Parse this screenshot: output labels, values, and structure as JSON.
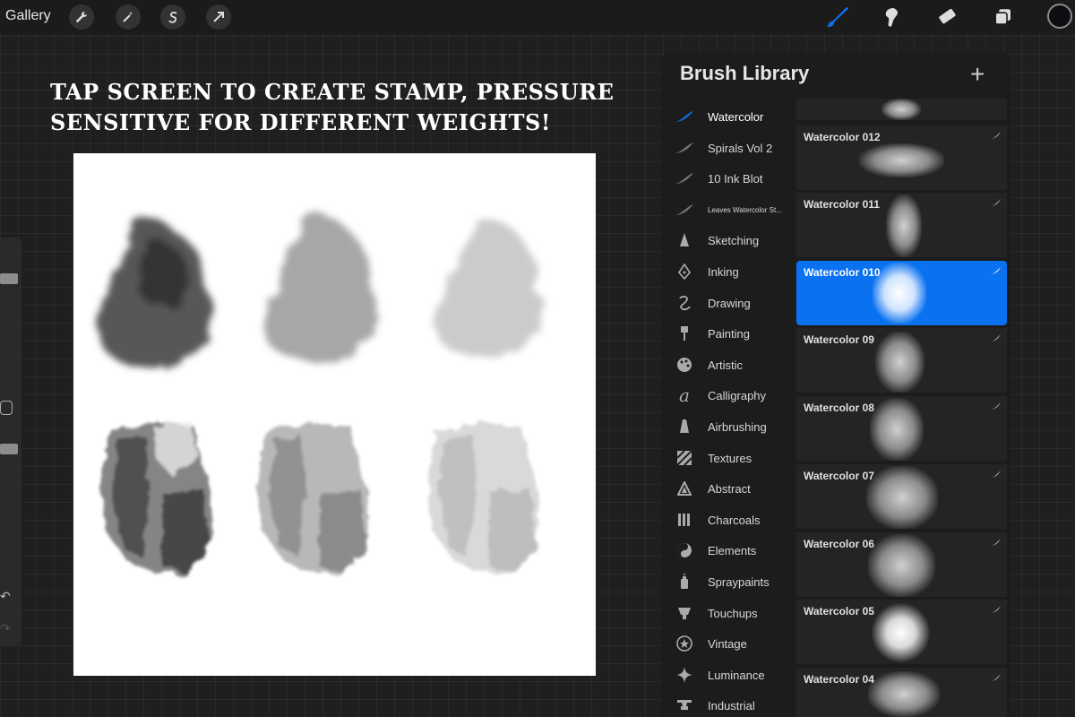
{
  "topbar": {
    "gallery_label": "Gallery",
    "left_tools": [
      "wrench-icon",
      "magic-wand-icon",
      "selection-s-icon",
      "arrow-icon"
    ],
    "right_tools": [
      "brush-icon",
      "smudge-icon",
      "eraser-icon",
      "layers-icon"
    ],
    "active_tool": "brush",
    "accent_color": "#0a72f0",
    "current_color": "#0e0e12"
  },
  "headline": {
    "line1": "TAP SCREEN TO CREATE STAMP, PRESSURE",
    "line2": "SENSITIVE FOR DIFFERENT WEIGHTS!"
  },
  "brush_library": {
    "title": "Brush Library",
    "add_label": "+",
    "categories": [
      {
        "label": "Watercolor",
        "icon": "custom-brush-icon",
        "active": true
      },
      {
        "label": "Spirals Vol 2",
        "icon": "custom-brush-icon"
      },
      {
        "label": "10 Ink Blot",
        "icon": "custom-brush-icon"
      },
      {
        "label": "Leaves Watercolor St...",
        "icon": "custom-brush-icon"
      },
      {
        "label": "Sketching",
        "icon": "pencil-tip-icon"
      },
      {
        "label": "Inking",
        "icon": "pen-nib-icon"
      },
      {
        "label": "Drawing",
        "icon": "squiggle-icon"
      },
      {
        "label": "Painting",
        "icon": "paint-brush-icon"
      },
      {
        "label": "Artistic",
        "icon": "palette-icon"
      },
      {
        "label": "Calligraphy",
        "icon": "calligraphy-a-icon"
      },
      {
        "label": "Airbrushing",
        "icon": "airbrush-icon"
      },
      {
        "label": "Textures",
        "icon": "texture-icon"
      },
      {
        "label": "Abstract",
        "icon": "triangle-icon"
      },
      {
        "label": "Charcoals",
        "icon": "charcoal-icon"
      },
      {
        "label": "Elements",
        "icon": "yin-yang-icon"
      },
      {
        "label": "Spraypaints",
        "icon": "spray-can-icon"
      },
      {
        "label": "Touchups",
        "icon": "touchup-icon"
      },
      {
        "label": "Vintage",
        "icon": "star-badge-icon"
      },
      {
        "label": "Luminance",
        "icon": "sparkle-icon"
      },
      {
        "label": "Industrial",
        "icon": "anvil-icon"
      }
    ],
    "brushes": [
      {
        "name": "Watercolor 012"
      },
      {
        "name": "Watercolor 011"
      },
      {
        "name": "Watercolor 010",
        "selected": true
      },
      {
        "name": "Watercolor 09"
      },
      {
        "name": "Watercolor 08"
      },
      {
        "name": "Watercolor 07"
      },
      {
        "name": "Watercolor 06"
      },
      {
        "name": "Watercolor 05"
      },
      {
        "name": "Watercolor 04"
      }
    ]
  }
}
